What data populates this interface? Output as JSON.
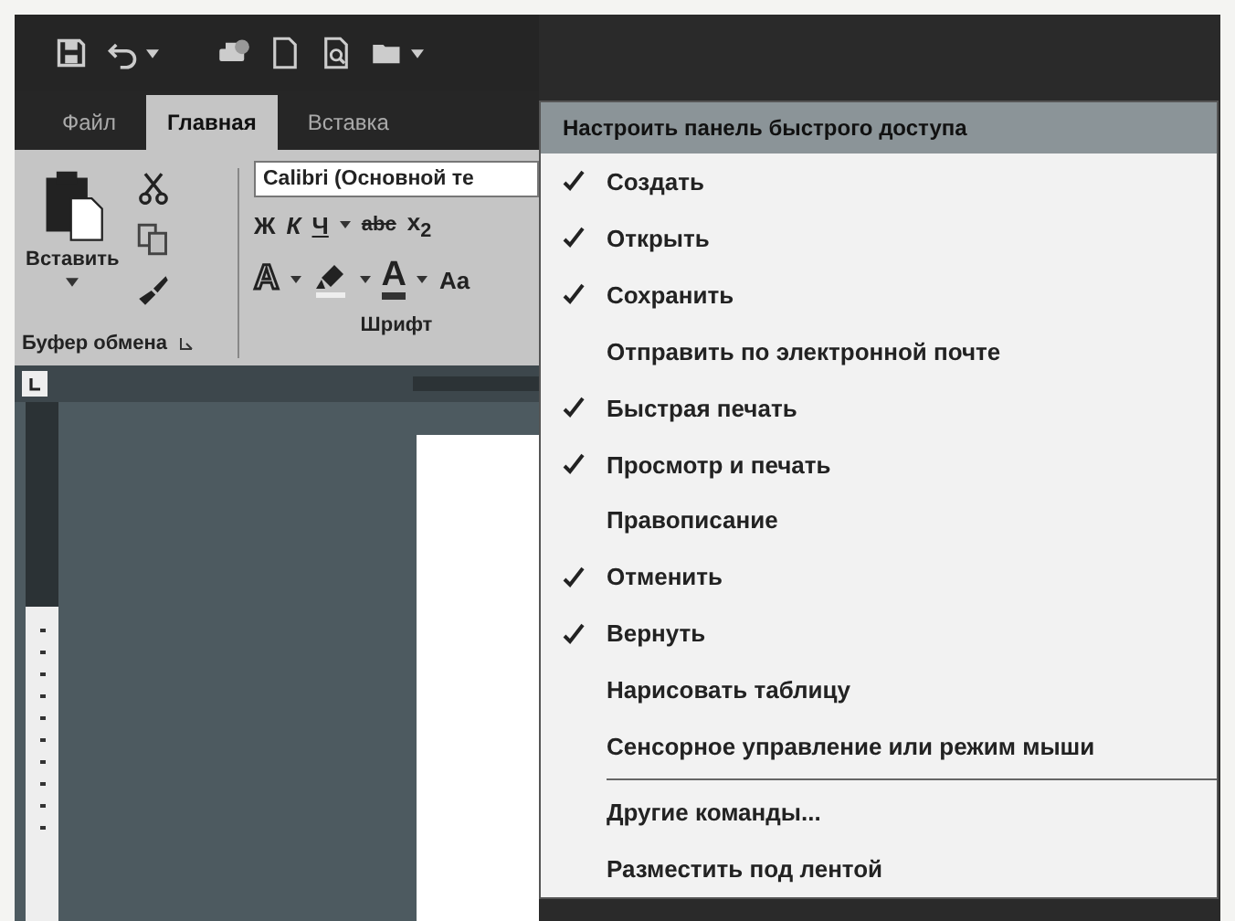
{
  "tabs": [
    {
      "label": "Файл",
      "selected": false
    },
    {
      "label": "Главная",
      "selected": true
    },
    {
      "label": "Вставка",
      "selected": false
    }
  ],
  "ribbon": {
    "clipboard": {
      "paste_label": "Вставить",
      "group_label": "Буфер обмена"
    },
    "font": {
      "font_name": "Calibri (Основной те",
      "format_buttons": [
        "Ж",
        "К",
        "Ч"
      ],
      "strike_label": "abc",
      "subscript": "x$_{2}$",
      "effects_letter": "A",
      "color_letter": "А",
      "case_label": "Aa",
      "group_label": "Шрифт"
    }
  },
  "menu": {
    "title": "Настроить панель быстрого доступа",
    "items": [
      {
        "label": "Создать",
        "checked": true,
        "kind": "option"
      },
      {
        "label": "Открыть",
        "checked": true,
        "kind": "option"
      },
      {
        "label": "Сохранить",
        "checked": true,
        "kind": "option"
      },
      {
        "label": "Отправить по электронной почте",
        "checked": false,
        "kind": "option"
      },
      {
        "label": "Быстрая печать",
        "checked": true,
        "kind": "option"
      },
      {
        "label": "Просмотр и печать",
        "checked": true,
        "kind": "option"
      },
      {
        "label": "Правописание",
        "checked": false,
        "kind": "option"
      },
      {
        "label": "Отменить",
        "checked": true,
        "kind": "option"
      },
      {
        "label": "Вернуть",
        "checked": true,
        "kind": "option"
      },
      {
        "label": "Нарисовать таблицу",
        "checked": false,
        "kind": "option"
      },
      {
        "label": "Сенсорное управление или режим мыши",
        "checked": false,
        "kind": "option"
      },
      {
        "label": "Другие команды...",
        "kind": "command"
      },
      {
        "label": "Разместить под лентой",
        "kind": "command"
      }
    ]
  }
}
